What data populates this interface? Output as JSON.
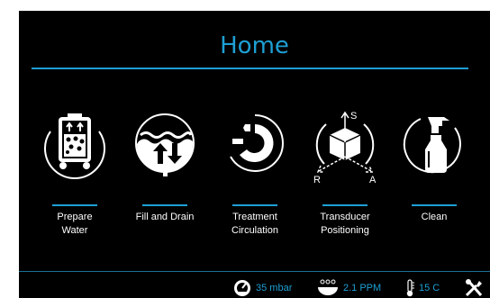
{
  "header": {
    "title": "Home"
  },
  "tiles": [
    {
      "id": "prepare",
      "label_line1": "Prepare",
      "label_line2": "Water",
      "icon": "water-tank-icon"
    },
    {
      "id": "fill",
      "label_line1": "Fill and Drain",
      "label_line2": "",
      "icon": "fill-drain-icon"
    },
    {
      "id": "treatment",
      "label_line1": "Treatment",
      "label_line2": "Circulation",
      "icon": "circulation-icon"
    },
    {
      "id": "transducer",
      "label_line1": "Transducer",
      "label_line2": "Positioning",
      "icon": "cube-axes-icon"
    },
    {
      "id": "clean",
      "label_line1": "Clean",
      "label_line2": "",
      "icon": "spray-bottle-icon"
    }
  ],
  "cube_axes": {
    "top": "S",
    "left": "R",
    "right": "A"
  },
  "status": {
    "pressure": "35 mbar",
    "oxygen": "2.1 PPM",
    "temperature": "15 C"
  },
  "colors": {
    "accent": "#1e9fd4",
    "background": "#000000",
    "text": "#ffffff"
  }
}
